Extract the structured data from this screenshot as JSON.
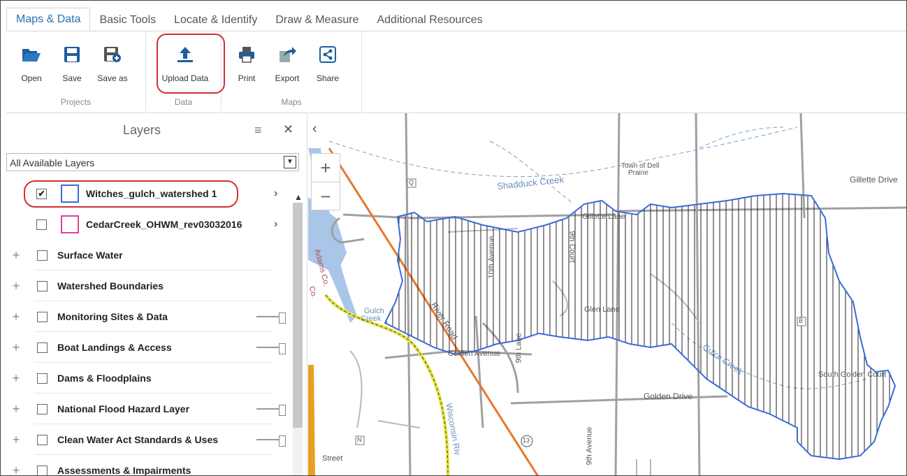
{
  "tabs": [
    "Maps & Data",
    "Basic Tools",
    "Locate & Identify",
    "Draw & Measure",
    "Additional Resources"
  ],
  "ribbon": {
    "projects": {
      "label": "Projects",
      "open": "Open",
      "save": "Save",
      "save_as": "Save as"
    },
    "data": {
      "label": "Data",
      "upload": "Upload Data"
    },
    "maps": {
      "label": "Maps",
      "print": "Print",
      "export": "Export",
      "share": "Share"
    }
  },
  "layers_panel": {
    "title": "Layers",
    "filter_value": "All Available Layers",
    "user_layers": [
      {
        "name": "Witches_gulch_watershed 1",
        "checked": true,
        "swatch": "#3a6bd8"
      },
      {
        "name": "CedarCreek_OHWM_rev03032016",
        "checked": false,
        "swatch": "#e040a0"
      }
    ],
    "groups": [
      {
        "name": "Surface Water"
      },
      {
        "name": "Watershed Boundaries"
      },
      {
        "name": "Monitoring Sites & Data"
      },
      {
        "name": "Boat Landings & Access"
      },
      {
        "name": "Dams & Floodplains"
      },
      {
        "name": "National Flood Hazard Layer"
      },
      {
        "name": "Clean Water Act Standards & Uses"
      },
      {
        "name": "Assessments & Impairments"
      }
    ]
  },
  "map": {
    "labels": {
      "shadduck_creek": "Shadduck Creek",
      "town": "Town of Dell",
      "town2": "Prairie",
      "gillette_drive": "Gillette Drive",
      "gillette_lane": "Gillette Lane",
      "tenth_avenue": "10th Avenue",
      "ninth_court": "9th Court",
      "glen_lane": "Glen Lane",
      "gulch_creek_left": "Gulch",
      "gulch_creek_left2": "Creek",
      "river_road": "River Road",
      "golden_avenue": "Golden Avenue",
      "ninth_lane": "9th Lane",
      "gulch_creek": "Gulch Creek",
      "golden_drive": "Golden Drive",
      "south_golden_court": "South Golden Court",
      "wisconsin_river": "Wisconsin Riv",
      "adams_co": "Adams Co.",
      "co": "Co.",
      "ninth_avenue": "9th Avenue",
      "street": "Street",
      "shield_q": "Q",
      "shield_b": "B",
      "shield_n": "N",
      "shield_13": "13"
    }
  }
}
